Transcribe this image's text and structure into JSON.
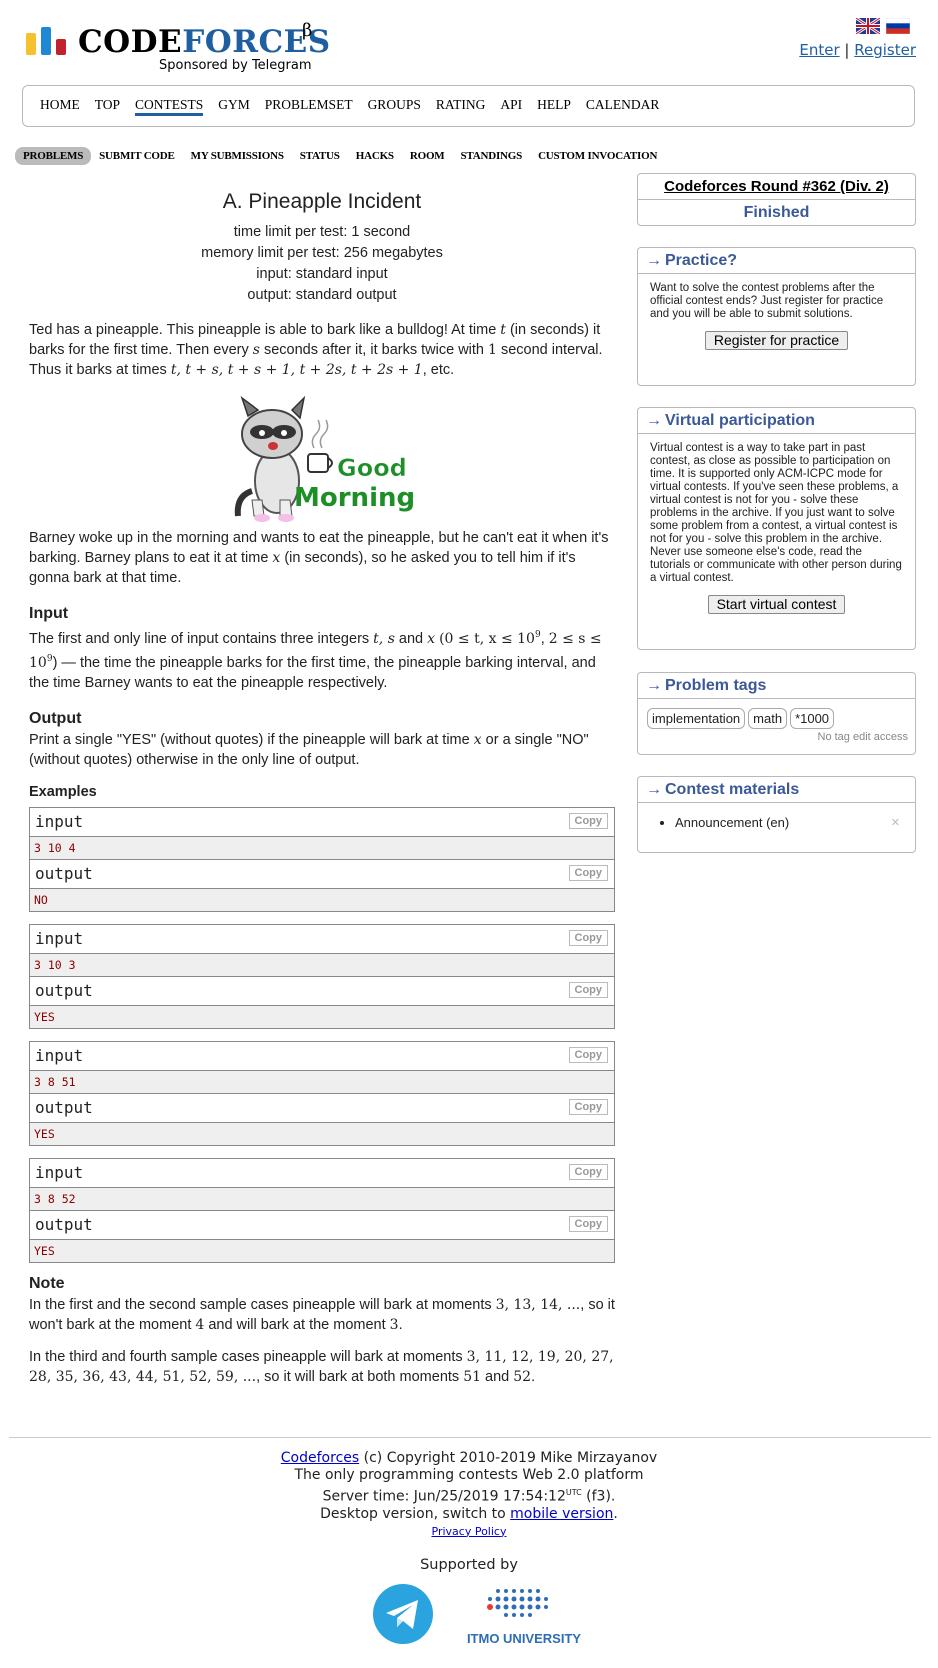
{
  "header": {
    "logo_word_1": "CODE",
    "logo_word_2": "FORCES",
    "logo_beta": "β",
    "logo_sponsor": "Sponsored by Telegram",
    "enter": "Enter",
    "separator": "|",
    "register": "Register"
  },
  "nav": {
    "items": [
      "HOME",
      "TOP",
      "CONTESTS",
      "GYM",
      "PROBLEMSET",
      "GROUPS",
      "RATING",
      "API",
      "HELP",
      "CALENDAR"
    ],
    "active": "CONTESTS"
  },
  "subnav": {
    "items": [
      "PROBLEMS",
      "SUBMIT CODE",
      "MY SUBMISSIONS",
      "STATUS",
      "HACKS",
      "ROOM",
      "STANDINGS",
      "CUSTOM INVOCATION"
    ],
    "active": "PROBLEMS"
  },
  "problem": {
    "title": "A. Pineapple Incident",
    "time_limit": "time limit per test: 1 second",
    "memory_limit": "memory limit per test: 256 megabytes",
    "input_file": "input: standard input",
    "output_file": "output: standard output",
    "legend_1a": "Ted has a pineapple. This pineapple is able to bark like a bulldog! At time ",
    "legend_1b": " (in seconds) it barks for the first time. Then every ",
    "legend_1c": " seconds after it, it barks twice with ",
    "legend_1d": " second interval. Thus it barks at times ",
    "legend_1e": ", etc.",
    "math_t": "t",
    "math_s": "s",
    "math_1": "1",
    "math_times": "t, t + s, t + s + 1, t + 2s, t + 2s + 1",
    "image_caption": "Good Morning",
    "legend_2a": "Barney woke up in the morning and wants to eat the pineapple, but he can't eat it when it's barking. Barney plans to eat it at time ",
    "legend_2b": " (in seconds), so he asked you to tell him if it's gonna bark at that time.",
    "math_x": "x",
    "input_title": "Input",
    "input_a": "The first and only line of input contains three integers ",
    "input_vars": "t, s",
    "input_and": " and ",
    "input_constraints_1": "(0 ≤ t, x ≤ 10",
    "input_exp": "9",
    "input_constraints_2": "2 ≤ s ≤ 10",
    "input_b": "— the time the pineapple barks for the first time, the pineapple barking interval, and the time Barney wants to eat the pineapple respectively.",
    "output_title": "Output",
    "output_a": "Print a single \"YES\" (without quotes) if the pineapple will bark at time ",
    "output_b": " or a single \"NO\" (without quotes) otherwise in the only line of output.",
    "examples_title": "Examples",
    "input_label": "input",
    "output_label": "output",
    "copy_label": "Copy",
    "samples": [
      {
        "input": "3 10 4",
        "output": "NO"
      },
      {
        "input": "3 10 3",
        "output": "YES"
      },
      {
        "input": "3 8 51",
        "output": "YES"
      },
      {
        "input": "3 8 52",
        "output": "YES"
      }
    ],
    "note_title": "Note",
    "note_1a": "In the first and the second sample cases pineapple will bark at moments ",
    "note_1_moments": "3, 13, 14, ...",
    "note_1b": ", so it won't bark at the moment ",
    "note_1_four": "4",
    "note_1c": " and will bark at the moment ",
    "note_1_three": "3",
    "note_1d": ".",
    "note_2a": "In the third and fourth sample cases pineapple will bark at moments ",
    "note_2_moments": "3, 11, 12, 19, 20, 27, 28, 35, 36, 43, 44, 51, 52, 59, ...",
    "note_2b": ", so it will bark at both moments ",
    "note_2_51": "51",
    "note_2_and": " and ",
    "note_2_52": "52",
    "note_2c": "."
  },
  "sidebar": {
    "round_title": "Codeforces Round #362 (Div. 2)",
    "round_status": "Finished",
    "arrow": "→",
    "practice_title": "Practice?",
    "practice_text": "Want to solve the contest problems after the official contest ends? Just register for practice and you will be able to submit solutions.",
    "practice_button": "Register for practice",
    "virtual_title": "Virtual participation",
    "virtual_text": "Virtual contest is a way to take part in past contest, as close as possible to participation on time. It is supported only ACM-ICPC mode for virtual contests. If you've seen these problems, a virtual contest is not for you - solve these problems in the archive. If you just want to solve some problem from a contest, a virtual contest is not for you - solve this problem in the archive. Never use someone else's code, read the tutorials or communicate with other person during a virtual contest.",
    "virtual_button": "Start virtual contest",
    "tags_title": "Problem tags",
    "tags": [
      "implementation",
      "math",
      "*1000"
    ],
    "tags_note": "No tag edit access",
    "materials_title": "Contest materials",
    "materials": [
      "Announcement (en)"
    ]
  },
  "footer": {
    "codeforces_link": "Codeforces",
    "copyright": " (c) Copyright 2010-2019 Mike Mirzayanov",
    "platform": "The only programming contests Web 2.0 platform",
    "server_time_label": "Server time: Jun/25/2019 17:54:12",
    "utc": "UTC",
    "f3": " (f3).",
    "desktop_text": "Desktop version, switch to ",
    "mobile_link": "mobile version",
    "period": ".",
    "privacy": "Privacy Policy",
    "supported_by": "Supported by",
    "itmo": "ITMO UNIVERSITY"
  },
  "colors": {
    "accent": "#3b5998",
    "logo_blue": "#1f5fa0",
    "logo_bar_yellow": "#f6c12e",
    "logo_bar_blue": "#1e88d4",
    "logo_bar_red": "#c0232c",
    "sample_text": "#8b0000",
    "telegram": "#2aa3df"
  }
}
